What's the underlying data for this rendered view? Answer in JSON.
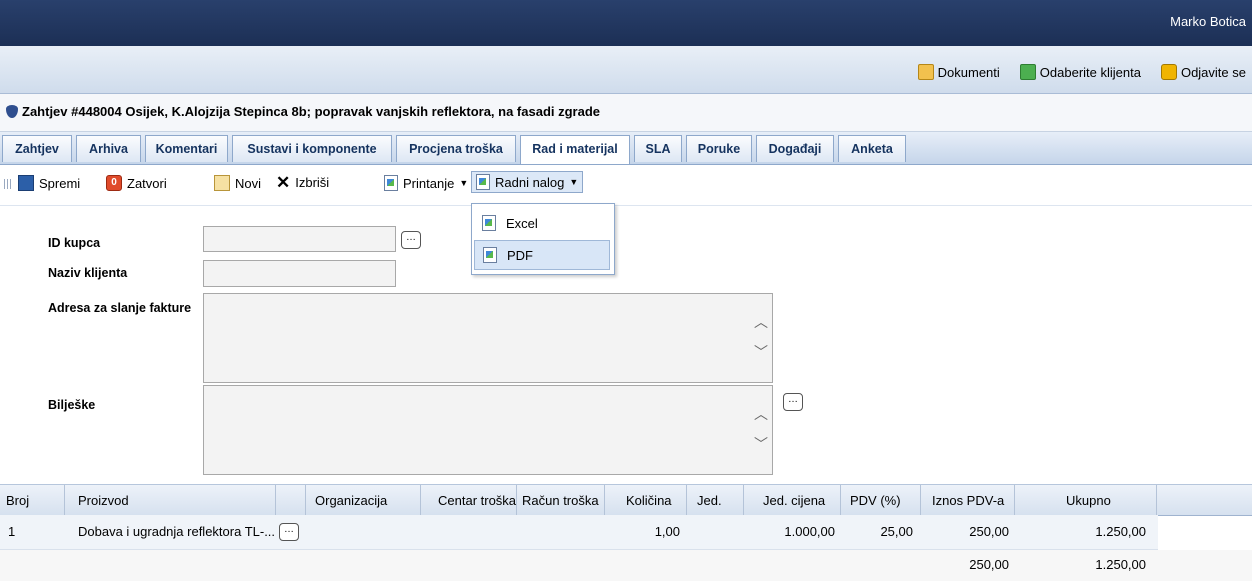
{
  "header": {
    "user_name": "Marko Botica"
  },
  "top_links": {
    "documents": "Dokumenti",
    "choose_client": "Odaberite klijenta",
    "logout": "Odjavite se"
  },
  "title": "Zahtjev #448004 Osijek, K.Alojzija Stepinca 8b; popravak vanjskih reflektora, na fasadi zgrade",
  "tabs": [
    "Zahtjev",
    "Arhiva",
    "Komentari",
    "Sustavi i komponente",
    "Procjena troška",
    "Rad i materijal",
    "SLA",
    "Poruke",
    "Događaji",
    "Anketa"
  ],
  "active_tab": "Rad i materijal",
  "toolbar": {
    "save": "Spremi",
    "close": "Zatvori",
    "new": "Novi",
    "delete": "Izbriši",
    "print": "Printanje",
    "work_order": "Radni nalog"
  },
  "dropdown": {
    "items": [
      "Excel",
      "PDF"
    ],
    "highlighted": "PDF"
  },
  "form": {
    "customer_id_label": "ID kupca",
    "client_name_label": "Naziv klijenta",
    "billing_address_label": "Adresa za slanje fakture",
    "notes_label": "Bilješke",
    "customer_id_value": "",
    "client_name_value": "",
    "billing_address_value": "",
    "notes_value": ""
  },
  "table": {
    "columns": [
      "Broj",
      "Proizvod",
      "Organizacija",
      "Centar troška",
      "Račun troška",
      "Količina",
      "Jed.",
      "Jed. cijena",
      "PDV (%)",
      "Iznos PDV-a",
      "Ukupno"
    ],
    "rows": [
      {
        "broj": "1",
        "proizvod": "Dobava i ugradnja reflektora TL-...",
        "organizacija": "",
        "centar": "",
        "racun": "",
        "kolicina": "1,00",
        "jed": "",
        "jed_cijena": "1.000,00",
        "pdv": "25,00",
        "iznos_pdv": "250,00",
        "ukupno": "1.250,00"
      }
    ],
    "totals": {
      "iznos_pdv": "250,00",
      "ukupno": "1.250,00"
    }
  }
}
